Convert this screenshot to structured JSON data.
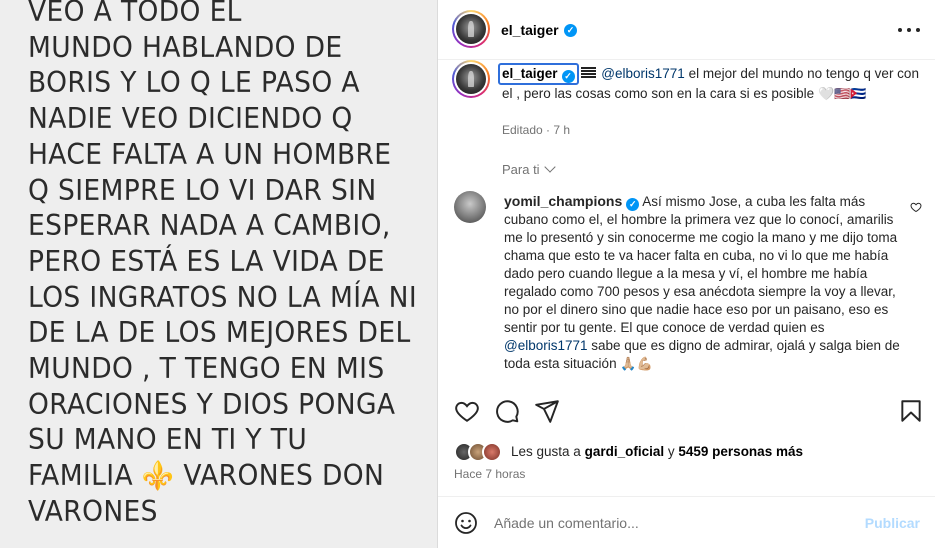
{
  "media": {
    "lines": [
      "VEO A TODO EL",
      "MUNDO HABLANDO DE",
      "BORIS Y LO Q LE PASO A",
      "NADIE VEO DICIENDO Q",
      "HACE FALTA A UN HOMBRE",
      "Q SIEMPRE LO VI DAR SIN",
      "ESPERAR NADA A CAMBIO,",
      "PERO ESTÁ ES LA VIDA DE",
      "LOS INGRATOS NO LA MÍA NI",
      "DE LA DE LOS MEJORES DEL",
      "MUNDO , T TENGO EN MIS",
      "ORACIONES Y DIOS PONGA",
      "SU MANO EN TI Y TU"
    ],
    "last_line_before": "FAMILIA",
    "fleur": "⚜️",
    "last_line_after": "VARONES DON",
    "final_line": "VARONES"
  },
  "header": {
    "username": "el_taiger",
    "avatar_icon": "profile-avatar",
    "more_icon": "more-options-icon"
  },
  "caption": {
    "username": "el_taiger",
    "mention": "@elboris1771",
    "text": " el mejor del mundo no tengo q ver con el , pero las cosas como son en la cara si es posible",
    "emojis": "🤍🇺🇸🇨🇺",
    "edited": "Editado",
    "dot": "·",
    "time": "7 h"
  },
  "sort": {
    "label": "Para ti"
  },
  "comment": {
    "username": "yomil_champions",
    "text_before": "Así mismo Jose, a cuba les falta más cubano como el, el hombre la primera vez que lo conocí, amarilis me lo presentó y sin conocerme me cogio la mano y me dijo toma chama que esto te va hacer falta en cuba, no vi lo que me había dado pero cuando llegue a la mesa y ví, el hombre me había regalado como 700 pesos y esa anécdota siempre la voy a llevar, no por el dinero sino que nadie hace eso por un paisano, eso es sentir por tu gente. El que conoce de verdad quien es ",
    "mention": "@elboris1771",
    "text_after": " sabe que es digno de admirar, ojalá y salga bien de toda esta situación ",
    "emojis": "🙏🏼💪🏼"
  },
  "likes": {
    "prefix": "Les gusta a",
    "user": "gardi_oficial",
    "joiner": "y",
    "count": "5459 personas más",
    "time": "Hace 7 horas"
  },
  "add_comment": {
    "placeholder": "Añade un comentario...",
    "publish": "Publicar"
  },
  "colors": {
    "verified": "#0095f6",
    "mention": "#00376b",
    "publish_disabled": "#b3dbff",
    "fleur": "#b8860b"
  }
}
